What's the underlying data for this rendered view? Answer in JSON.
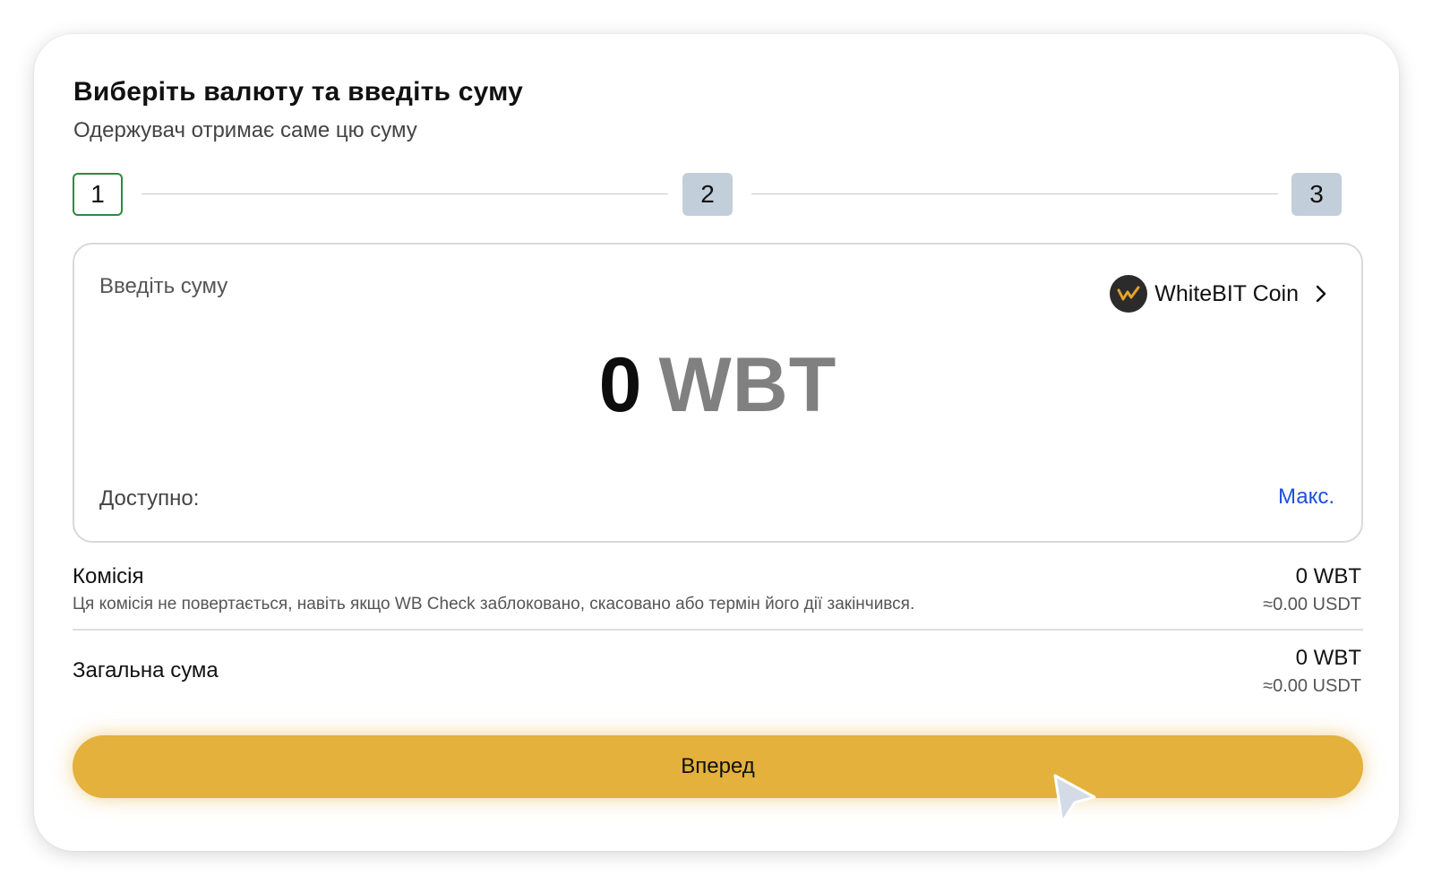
{
  "header": {
    "title": "Виберіть валюту та введіть суму",
    "subtitle": "Одержувач отримає саме цю суму"
  },
  "stepper": {
    "steps": [
      "1",
      "2",
      "3"
    ],
    "active_step": 1,
    "active_color": "#2e8b3d",
    "inactive_color": "#c3cedb"
  },
  "amount_input": {
    "label": "Введіть суму",
    "value": "0",
    "currency": "WBT",
    "available_label": "Доступно:",
    "max_label": "Макс."
  },
  "coin_selector": {
    "name": "WhiteBIT Coin",
    "icon": "whitebit-coin-icon",
    "chevron": "chevron-right-icon"
  },
  "fee": {
    "title": "Комісія",
    "note": "Ця комісія не повертається, навіть якщо WB Check заблоковано, скасовано або термін його дії закінчився.",
    "amount": "0 WBT",
    "usdt": "≈0.00 USDT"
  },
  "total": {
    "title": "Загальна сума",
    "amount": "0 WBT",
    "usdt": "≈0.00 USDT"
  },
  "actions": {
    "next_label": "Вперед",
    "button_color": "#e3b13c",
    "link_color": "#1e4fdc"
  }
}
